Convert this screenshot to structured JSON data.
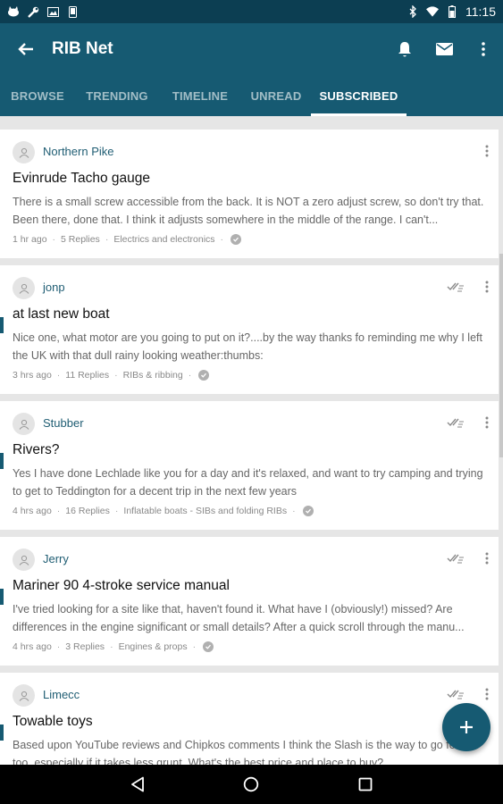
{
  "status_bar": {
    "time": "11:15",
    "icons_left": [
      "cat-app-icon",
      "wrench-icon",
      "image-icon",
      "phone-icon"
    ],
    "icons_right": [
      "bluetooth-icon",
      "wifi-icon",
      "battery-icon"
    ]
  },
  "app_bar": {
    "title": "RIB Net",
    "actions": [
      "bell-icon",
      "mail-icon",
      "overflow-menu-icon"
    ]
  },
  "tabs": [
    {
      "label": "BROWSE",
      "active": false
    },
    {
      "label": "TRENDING",
      "active": false
    },
    {
      "label": "TIMELINE",
      "active": false
    },
    {
      "label": "UNREAD",
      "active": false
    },
    {
      "label": "SUBSCRIBED",
      "active": true
    }
  ],
  "threads": [
    {
      "author": "Northern Pike",
      "title": "Evinrude Tacho gauge",
      "excerpt": "There is a small screw accessible from the back. It is NOT a zero adjust screw, so don't try that. Been there, done that. I think it adjusts somewhere in the middle of the range. I can't...",
      "time": "1 hr ago",
      "replies": "5 Replies",
      "forum": "Electrics and electronics",
      "unread": false
    },
    {
      "author": "jonp",
      "title": "at last new boat",
      "excerpt": "Nice one, what motor are you going to put on it?....by the way thanks fo reminding me why I left the UK with that dull rainy looking weather:thumbs:",
      "time": "3 hrs ago",
      "replies": "11 Replies",
      "forum": "RIBs & ribbing",
      "unread": true
    },
    {
      "author": "Stubber",
      "title": "Rivers?",
      "excerpt": "Yes I have done Lechlade like you for a day and it's relaxed, and want to try camping and trying to get to Teddington for a decent trip in the next few years",
      "time": "4 hrs ago",
      "replies": "16 Replies",
      "forum": "Inflatable boats - SIBs and folding RIBs",
      "unread": true
    },
    {
      "author": "Jerry",
      "title": "Mariner 90 4-stroke service manual",
      "excerpt": "I've tried looking for a site like that, haven't found it. What have I (obviously!) missed? Are differences in the engine significant or small details? After a quick scroll through the manu...",
      "time": "4 hrs ago",
      "replies": "3 Replies",
      "forum": "Engines & props",
      "unread": true
    },
    {
      "author": "Limecc",
      "title": "Towable toys",
      "excerpt": "Based upon YouTube reviews and Chipkos comments I think the Slash is the way to go for us too, especially if it takes less grunt. What's the best price and place to buy?",
      "time": "",
      "replies": "",
      "forum": "",
      "unread": true
    }
  ],
  "fab": {
    "icon": "plus-icon"
  },
  "nav_bar": [
    "back-nav-icon",
    "home-nav-icon",
    "recents-nav-icon"
  ]
}
